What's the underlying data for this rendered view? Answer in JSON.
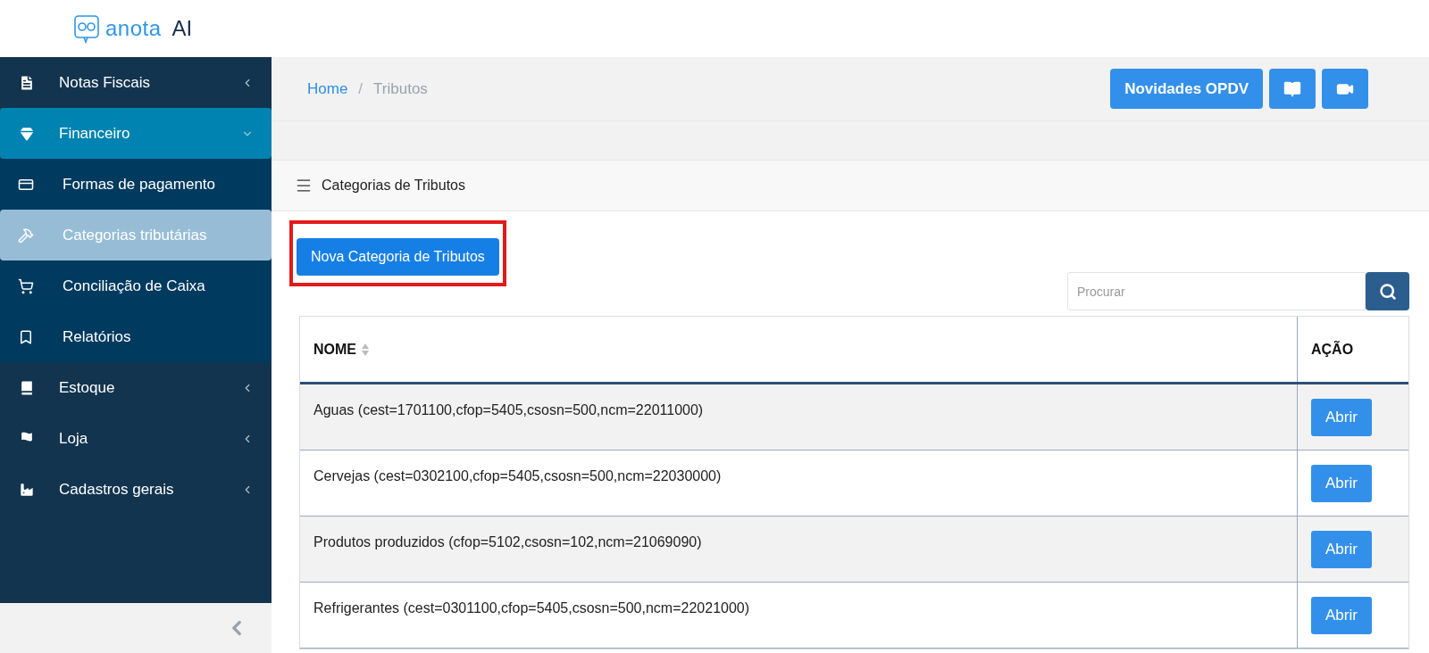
{
  "brand": {
    "name": "anota",
    "suffix": "AI"
  },
  "sidebar": {
    "items": [
      {
        "label": "Notas Fiscais",
        "expanded": false,
        "selected": false
      },
      {
        "label": "Financeiro",
        "expanded": true,
        "selected": true,
        "children": [
          {
            "label": "Formas de pagamento",
            "selected": false
          },
          {
            "label": "Categorias tributárias",
            "selected": true
          },
          {
            "label": "Conciliação de Caixa",
            "selected": false
          },
          {
            "label": "Relatórios",
            "selected": false
          }
        ]
      },
      {
        "label": "Estoque",
        "expanded": false,
        "selected": false
      },
      {
        "label": "Loja",
        "expanded": false,
        "selected": false
      },
      {
        "label": "Cadastros gerais",
        "expanded": false,
        "selected": false
      }
    ]
  },
  "breadcrumb": {
    "items": [
      "Home",
      "Tributos"
    ],
    "separator": "/"
  },
  "toolbar": {
    "news_button": "Novidades OPDV"
  },
  "card": {
    "title": "Categorias de Tributos",
    "new_button": {
      "label": "Nova Categoria de Tributos",
      "highlighted": true
    },
    "search": {
      "placeholder": "Procurar"
    },
    "table": {
      "columns": [
        "NOME",
        "AÇÃO"
      ],
      "rows": [
        {
          "name": "Aguas (cest=1701100,cfop=5405,csosn=500,ncm=22011000)",
          "action": "Abrir"
        },
        {
          "name": "Cervejas (cest=0302100,cfop=5405,csosn=500,ncm=22030000)",
          "action": "Abrir"
        },
        {
          "name": "Produtos produzidos (cfop=5102,csosn=102,ncm=21069090)",
          "action": "Abrir"
        },
        {
          "name": "Refrigerantes (cest=0301100,cfop=5405,csosn=500,ncm=22021000)",
          "action": "Abrir"
        }
      ]
    }
  }
}
